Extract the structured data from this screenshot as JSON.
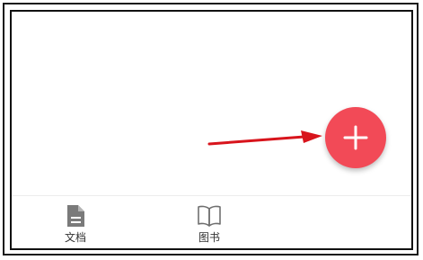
{
  "fab": {
    "icon": "plus-icon",
    "color": "#f24a57"
  },
  "annotation": {
    "icon": "red-arrow-icon",
    "color": "#d8141c"
  },
  "bottom_nav": {
    "items": [
      {
        "label": "文档",
        "icon": "document-icon"
      },
      {
        "label": "图书",
        "icon": "book-icon"
      }
    ]
  }
}
